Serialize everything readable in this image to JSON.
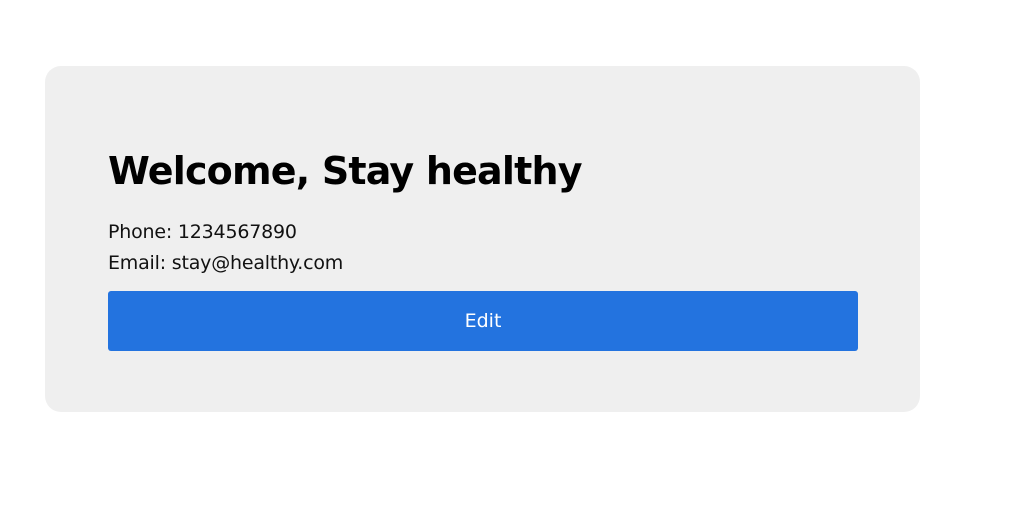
{
  "profile_card": {
    "title": "Welcome, Stay healthy",
    "phone": "Phone: 1234567890",
    "email": "Email: stay@healthy.com",
    "edit_label": "Edit"
  },
  "colors": {
    "card_background": "#efefef",
    "button_background": "#2373df",
    "button_text": "#ffffff",
    "title_text": "#000000"
  }
}
